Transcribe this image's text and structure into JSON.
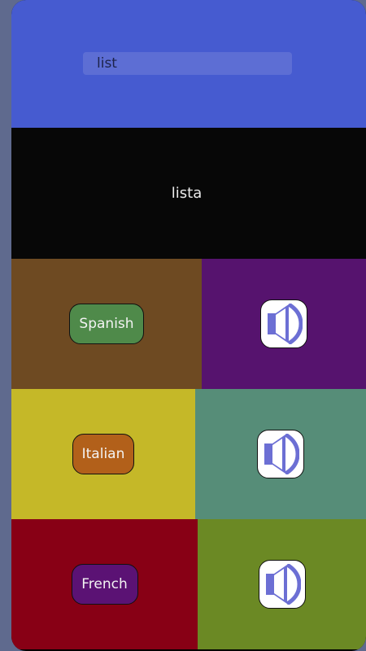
{
  "search": {
    "value": "list",
    "placeholder": ""
  },
  "result": {
    "text": "lista"
  },
  "languages": [
    {
      "label": "Spanish",
      "panel_color": "#6e4a22",
      "button_color": "#4f8a4a",
      "audio_panel_color": "#56136e",
      "speaker_icon": "speaker-icon"
    },
    {
      "label": "Italian",
      "panel_color": "#c5b828",
      "button_color": "#b2601a",
      "audio_panel_color": "#568d78",
      "speaker_icon": "speaker-icon"
    },
    {
      "label": "French",
      "panel_color": "#880015",
      "button_color": "#5b1274",
      "audio_panel_color": "#6b8924",
      "speaker_icon": "speaker-icon"
    }
  ],
  "colors": {
    "header_bg": "#465bd0",
    "result_bg": "#070707",
    "speaker_accent": "#6c6fd4"
  }
}
